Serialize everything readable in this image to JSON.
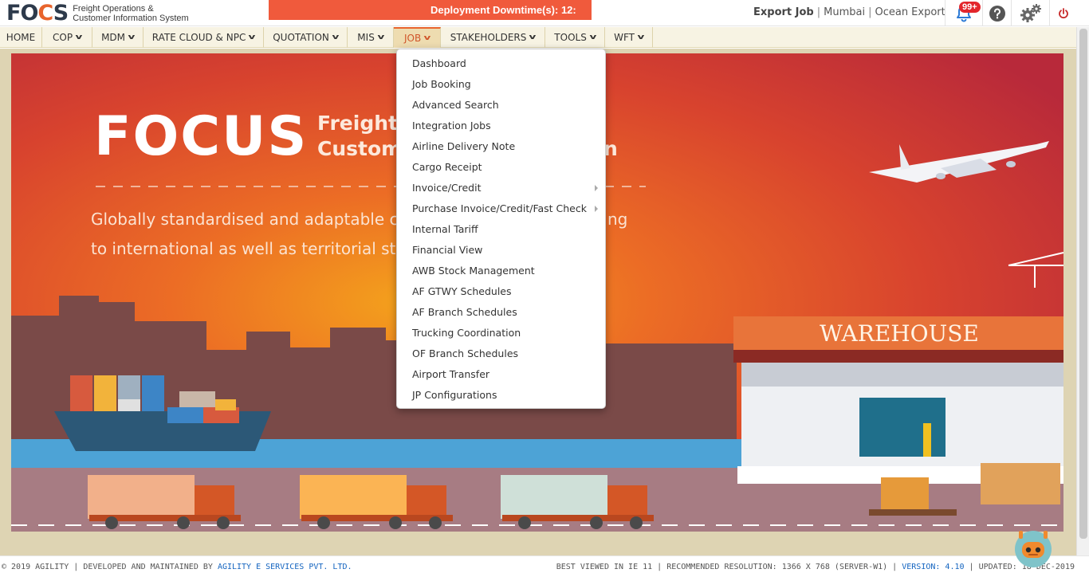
{
  "app": {
    "logo_text": "FOCUS",
    "logo_subtitle_line1": "Freight Operations &",
    "logo_subtitle_line2": "Customer Information System"
  },
  "banner": {
    "text": "Deployment Downtime(s): 12:"
  },
  "context": {
    "job_type": "Export Job",
    "location": "Mumbai",
    "mode": "Ocean Export",
    "separator": "|"
  },
  "notifications": {
    "count": "99+"
  },
  "nav": {
    "items": [
      {
        "label": "HOME",
        "has_caret": false
      },
      {
        "label": "COP",
        "has_caret": true
      },
      {
        "label": "MDM",
        "has_caret": true
      },
      {
        "label": "RATE CLOUD & NPC",
        "has_caret": true
      },
      {
        "label": "QUOTATION",
        "has_caret": true
      },
      {
        "label": "MIS",
        "has_caret": true
      },
      {
        "label": "JOB",
        "has_caret": true,
        "active": true
      },
      {
        "label": "STAKEHOLDERS",
        "has_caret": true
      },
      {
        "label": "TOOLS",
        "has_caret": true
      },
      {
        "label": "WFT",
        "has_caret": true
      }
    ]
  },
  "job_menu": {
    "items": [
      {
        "label": "Dashboard",
        "submenu": false
      },
      {
        "label": "Job Booking",
        "submenu": false
      },
      {
        "label": "Advanced Search",
        "submenu": false
      },
      {
        "label": "Integration Jobs",
        "submenu": false
      },
      {
        "label": "Airline Delivery Note",
        "submenu": false
      },
      {
        "label": "Cargo Receipt",
        "submenu": false
      },
      {
        "label": "Invoice/Credit",
        "submenu": true
      },
      {
        "label": "Purchase Invoice/Credit/Fast Check",
        "submenu": true
      },
      {
        "label": "Internal Tariff",
        "submenu": false
      },
      {
        "label": "Financial View",
        "submenu": false
      },
      {
        "label": "AWB Stock Management",
        "submenu": false
      },
      {
        "label": "AF GTWY Schedules",
        "submenu": false
      },
      {
        "label": "AF Branch Schedules",
        "submenu": false
      },
      {
        "label": "Trucking Coordination",
        "submenu": false
      },
      {
        "label": "OF Branch Schedules",
        "submenu": false
      },
      {
        "label": "Airport Transfer",
        "submenu": false
      },
      {
        "label": "JP Configurations",
        "submenu": false
      }
    ]
  },
  "hero": {
    "logo": "FOCUS",
    "heading_line1": "Freight O",
    "heading_line2": "Custome",
    "heading_tail": "n",
    "tagline_line1": "Globally standardised and adaptable co",
    "tagline_tail1": "ng",
    "tagline_line2": "to international as well as territorial sta",
    "warehouse_sign": "WAREHOUSE"
  },
  "footer": {
    "copyright": "© 2019 AGILITY | DEVELOPED AND MAINTAINED BY",
    "developer": "AGILITY E SERVICES PVT. LTD.",
    "best_viewed": "BEST VIEWED IN IE 11 | RECOMMENDED RESOLUTION: 1366 X 768 (SERVER-W1) |",
    "version": "VERSION: 4.10",
    "updated": "| UPDATED: 18-DEC-2019"
  },
  "colors": {
    "accent": "#e8642c",
    "banner": "#f05a3c",
    "menubar": "#f7f3e3",
    "badge": "#e3262c",
    "hero_frame": "#ded4b3",
    "link": "#1565c0"
  }
}
